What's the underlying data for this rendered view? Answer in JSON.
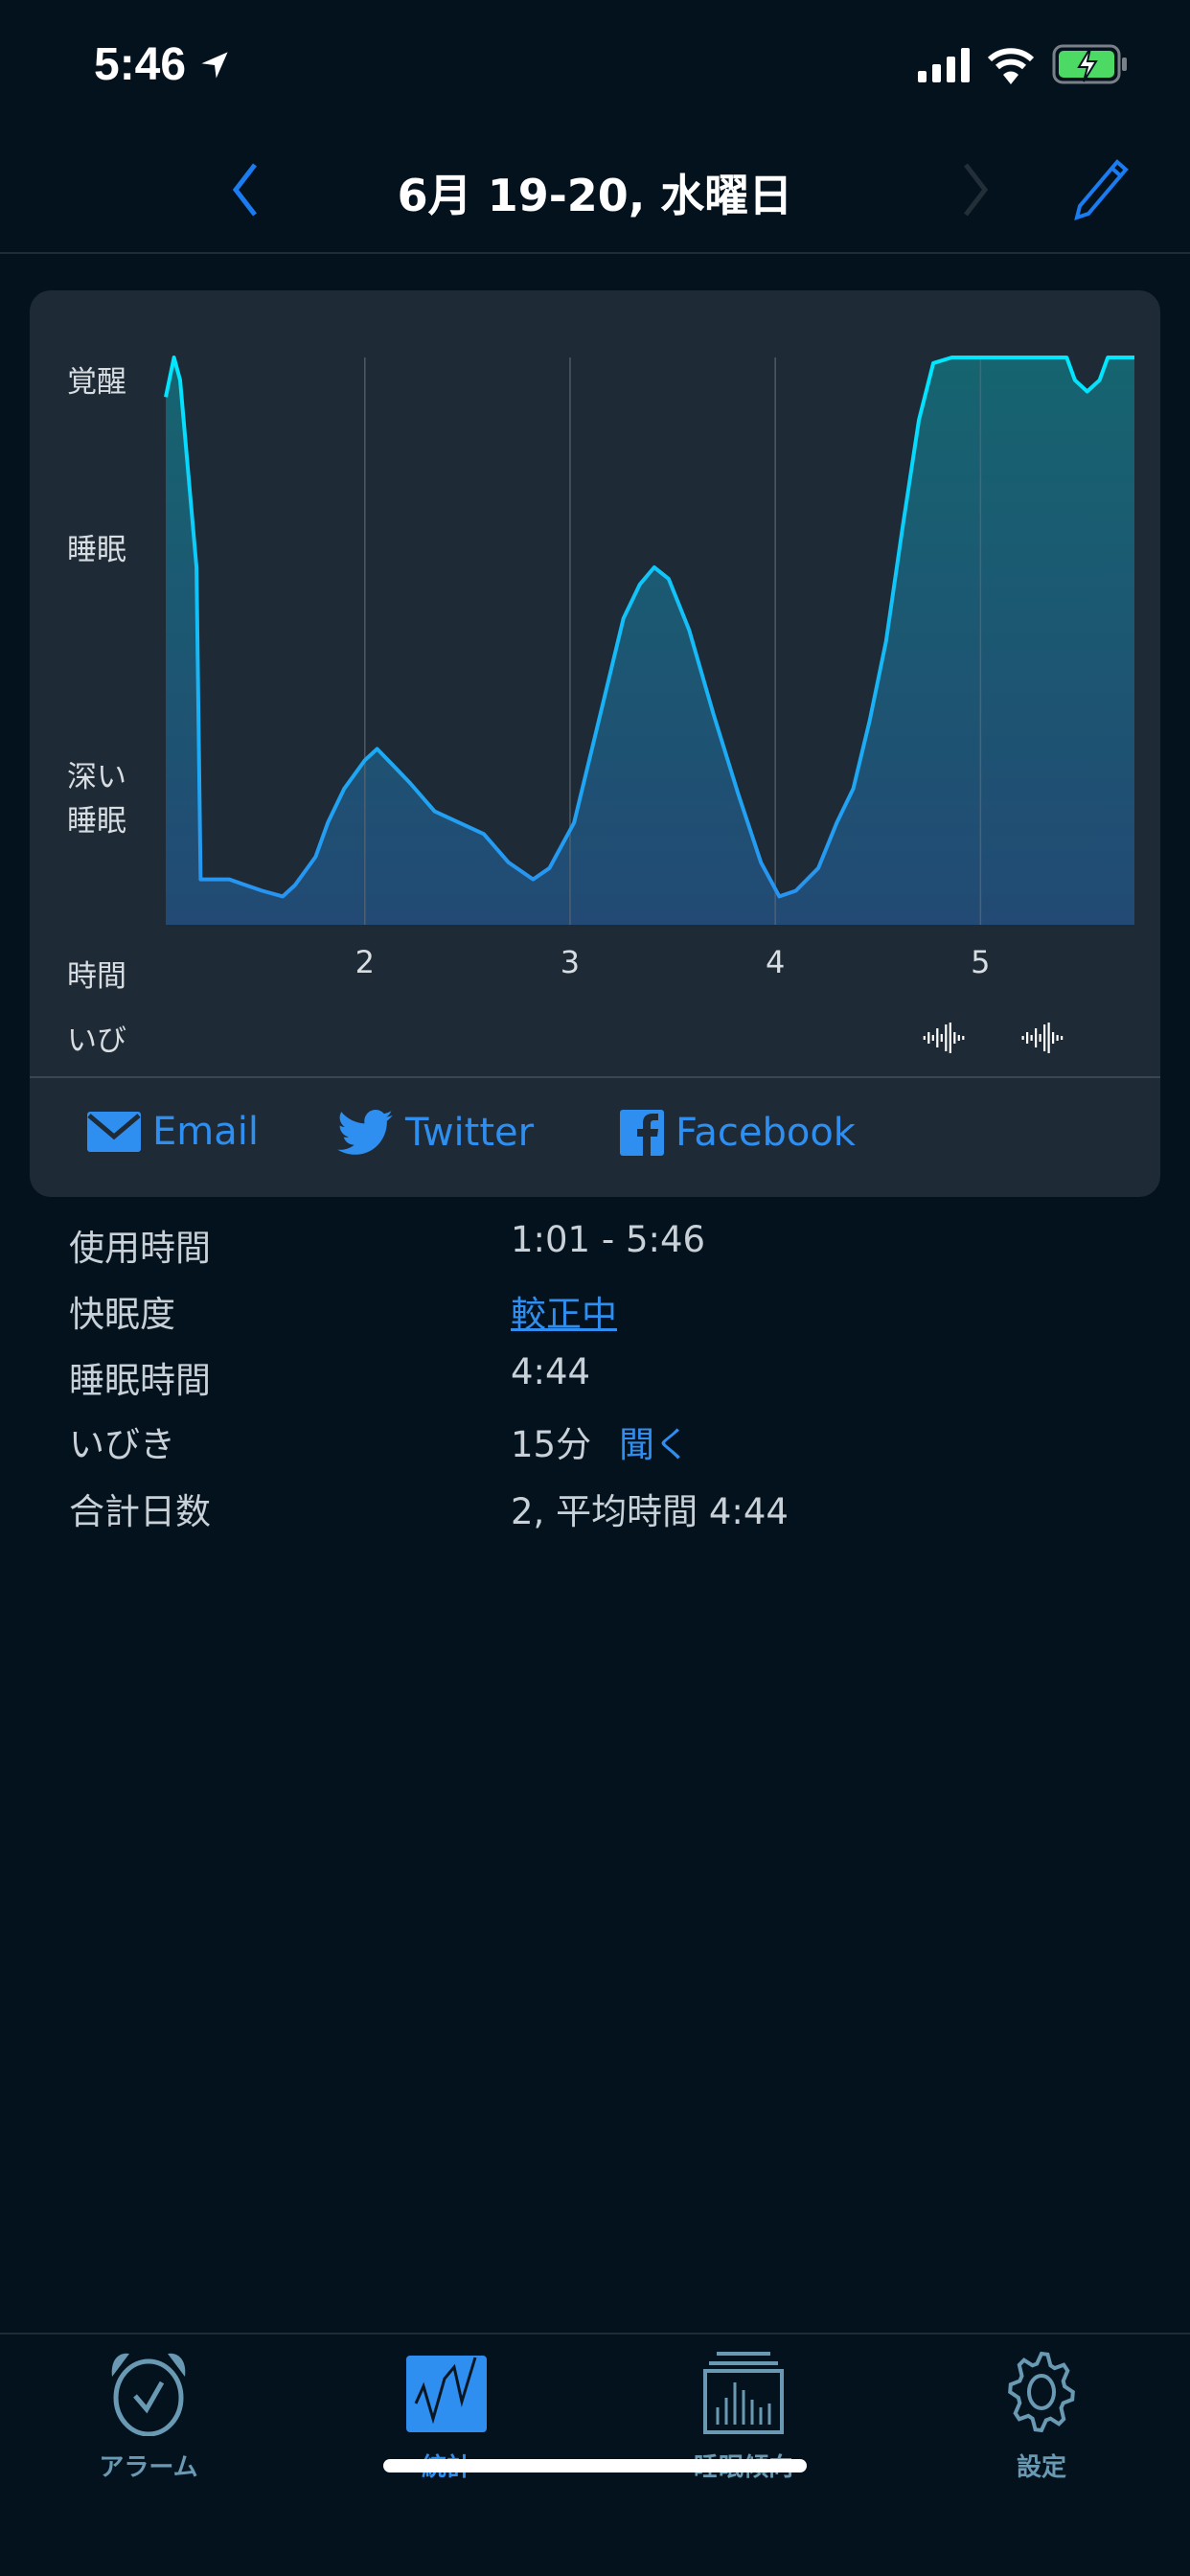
{
  "status_bar": {
    "time": "5:46"
  },
  "nav": {
    "title": "6月 19-20, 水曜日",
    "back_icon": "chevron-left-icon",
    "forward_icon": "chevron-right-icon",
    "edit_icon": "pencil-icon"
  },
  "chart_data": {
    "type": "area",
    "xlabel": "時間",
    "x_ticks": [
      2,
      3,
      4,
      5
    ],
    "xlim": [
      1.03,
      5.75
    ],
    "y_levels": [
      {
        "label": "覚醒",
        "value": 97
      },
      {
        "label": "睡眠",
        "value": 67
      },
      {
        "label": "深い\n睡眠",
        "value": 23
      }
    ],
    "ylim": [
      0,
      100
    ],
    "grid": "vertical",
    "points": [
      [
        1.03,
        93
      ],
      [
        1.07,
        100
      ],
      [
        1.1,
        96
      ],
      [
        1.18,
        63
      ],
      [
        1.2,
        8
      ],
      [
        1.26,
        8
      ],
      [
        1.34,
        8
      ],
      [
        1.42,
        7
      ],
      [
        1.5,
        6
      ],
      [
        1.6,
        5
      ],
      [
        1.66,
        7
      ],
      [
        1.76,
        12
      ],
      [
        1.82,
        18
      ],
      [
        1.9,
        24
      ],
      [
        2.0,
        29
      ],
      [
        2.06,
        31
      ],
      [
        2.14,
        28
      ],
      [
        2.22,
        25
      ],
      [
        2.34,
        20
      ],
      [
        2.46,
        18
      ],
      [
        2.58,
        16
      ],
      [
        2.7,
        11
      ],
      [
        2.82,
        8
      ],
      [
        2.9,
        10
      ],
      [
        3.02,
        18
      ],
      [
        3.14,
        36
      ],
      [
        3.26,
        54
      ],
      [
        3.34,
        60
      ],
      [
        3.41,
        63
      ],
      [
        3.48,
        61
      ],
      [
        3.58,
        52
      ],
      [
        3.7,
        37
      ],
      [
        3.82,
        23
      ],
      [
        3.93,
        11
      ],
      [
        4.02,
        5
      ],
      [
        4.1,
        6
      ],
      [
        4.21,
        10
      ],
      [
        4.3,
        18
      ],
      [
        4.38,
        24
      ],
      [
        4.46,
        36
      ],
      [
        4.54,
        50
      ],
      [
        4.62,
        70
      ],
      [
        4.7,
        89
      ],
      [
        4.77,
        99
      ],
      [
        4.86,
        100
      ],
      [
        5.02,
        100
      ],
      [
        5.18,
        100
      ],
      [
        5.42,
        100
      ],
      [
        5.46,
        96
      ],
      [
        5.52,
        94
      ],
      [
        5.58,
        96
      ],
      [
        5.62,
        100
      ],
      [
        5.75,
        100
      ]
    ],
    "snore_label": "いび",
    "snore_events": [
      4.82,
      5.3
    ],
    "colors": {
      "line_top": "#00e8ff",
      "line_bottom": "#2a8ff0",
      "fill_top": "#166470",
      "fill_bottom": "#224a74"
    }
  },
  "share": {
    "email": "Email",
    "twitter": "Twitter",
    "facebook": "Facebook"
  },
  "stats": [
    {
      "label": "使用時間",
      "value": "1:01 - 5:46"
    },
    {
      "label": "快眠度",
      "value": "較正中"
    },
    {
      "label": "睡眠時間",
      "value": "4:44"
    },
    {
      "label": "いびき",
      "value": "15分",
      "link": "聞く"
    },
    {
      "label": "合計日数",
      "value": "2, 平均時間 4:44"
    }
  ],
  "tabs": [
    {
      "label": "アラーム",
      "icon": "alarm-clock-icon"
    },
    {
      "label": "統計",
      "icon": "stats-chart-icon",
      "active": true
    },
    {
      "label": "睡眠傾向",
      "icon": "sleep-trend-icon"
    },
    {
      "label": "設定",
      "icon": "gear-icon"
    }
  ],
  "accent": "#2f8ff0"
}
